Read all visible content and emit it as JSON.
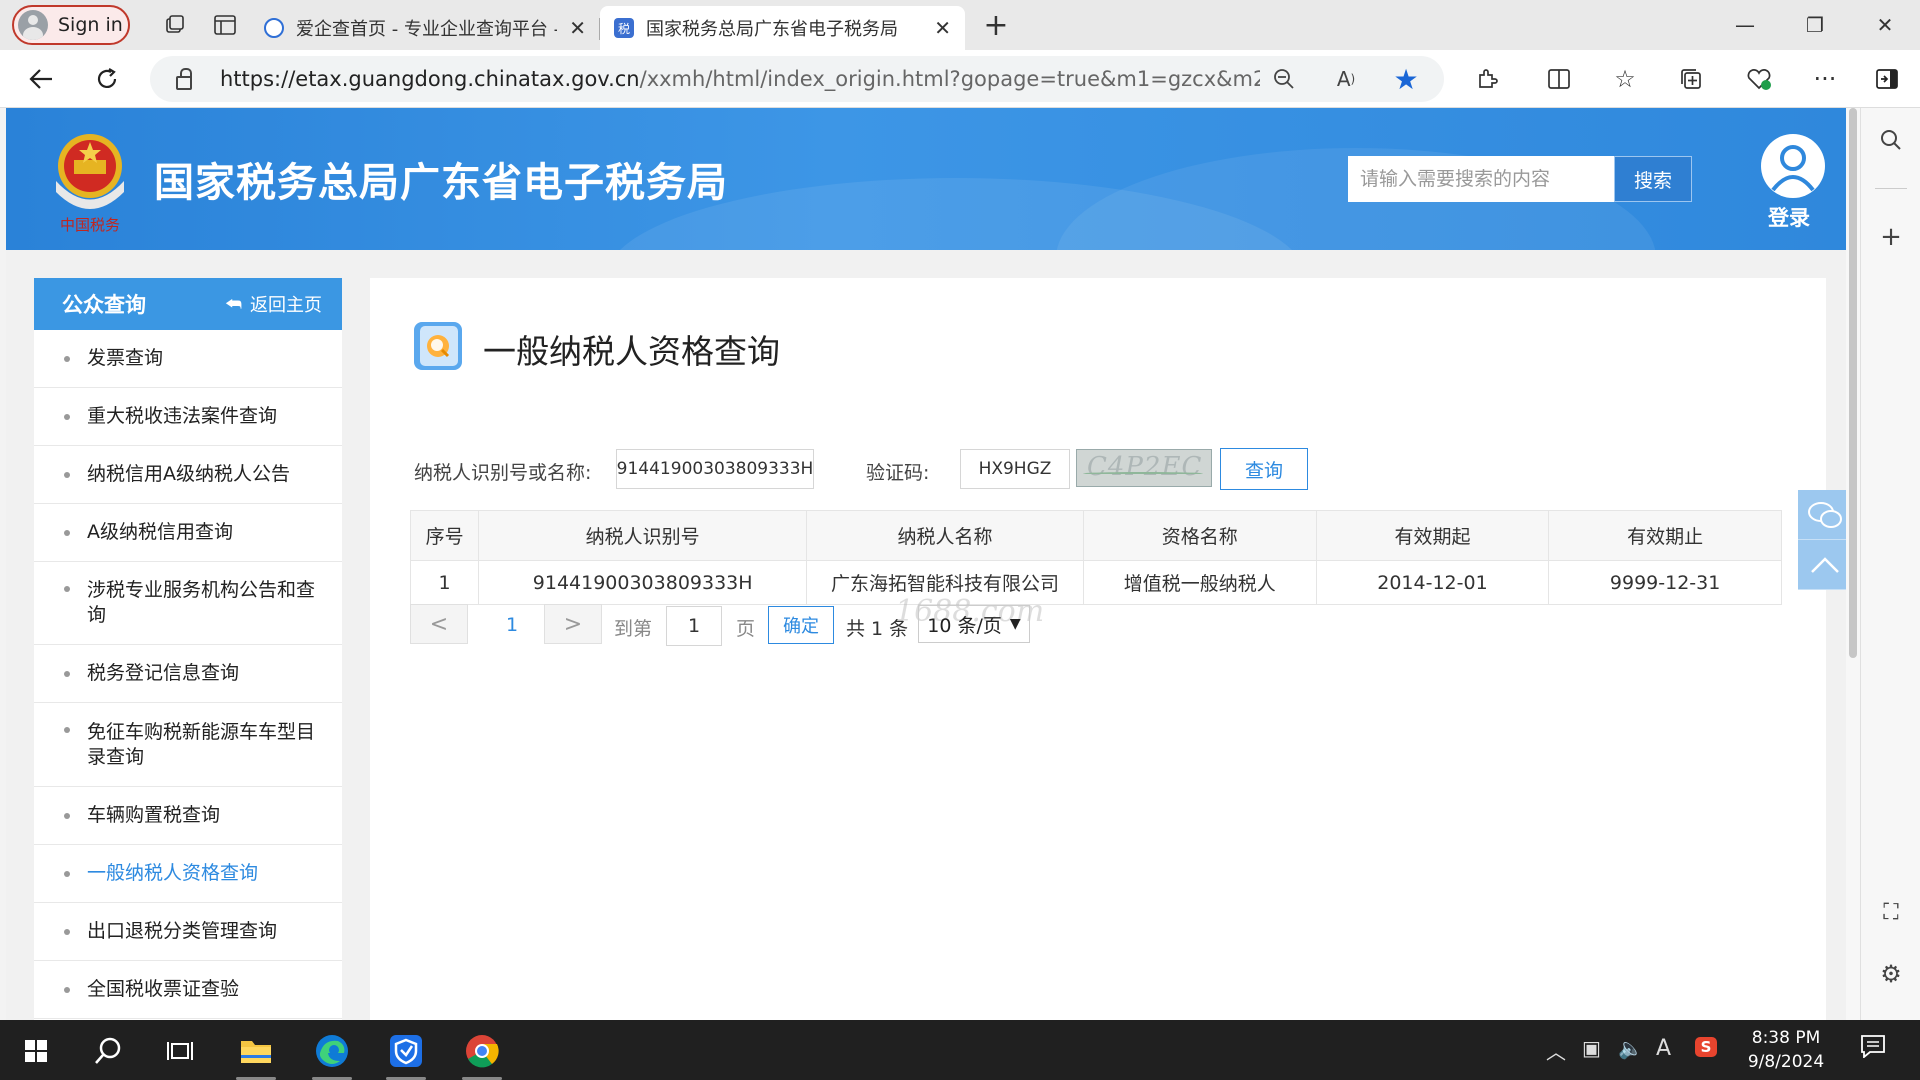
{
  "browser": {
    "signin_label": "Sign in",
    "tabs": [
      {
        "title": "爱企查首页 - 专业企业查询平台 -",
        "favicon_color": "#2f6fd6"
      },
      {
        "title": "国家税务总局广东省电子税务局",
        "favicon_color": "#3b6fd0"
      }
    ],
    "url_main": "https://etax.guangdong.chinatax.gov.cn",
    "url_rest": "/xxmh/html/index_origin.html?gopage=true&m1=gzcx&m2=&from..."
  },
  "site": {
    "title": "国家税务总局广东省电子税务局",
    "search_placeholder": "请输入需要搜索的内容",
    "search_button": "搜索",
    "login_label": "登录",
    "emblem_caption": "中国税务"
  },
  "menu": {
    "header": "公众查询",
    "back_label": "返回主页",
    "items": [
      {
        "label": "发票查询"
      },
      {
        "label": "重大税收违法案件查询"
      },
      {
        "label": "纳税信用A级纳税人公告"
      },
      {
        "label": "A级纳税信用查询"
      },
      {
        "label": "涉税专业服务机构公告和查询"
      },
      {
        "label": "税务登记信息查询"
      },
      {
        "label": "免征车购税新能源车车型目录查询"
      },
      {
        "label": "车辆购置税查询"
      },
      {
        "label": "一般纳税人资格查询"
      },
      {
        "label": "出口退税分类管理查询"
      },
      {
        "label": "全国税收票证查验"
      }
    ],
    "active_index": 8
  },
  "main": {
    "title": "一般纳税人资格查询",
    "taxpayer_label": "纳税人识别号或名称:",
    "taxpayer_value": "91441900303809333H",
    "captcha_label": "验证码:",
    "captcha_value": "HX9HGZ",
    "captcha_image_text": "C4P2EC",
    "query_button": "查询",
    "watermark": "1688.com",
    "table": {
      "headers": [
        "序号",
        "纳税人识别号",
        "纳税人名称",
        "资格名称",
        "有效期起",
        "有效期止"
      ],
      "rows": [
        [
          "1",
          "91441900303809333H",
          "广东海拓智能科技有限公司",
          "增值税一般纳税人",
          "2014-12-01",
          "9999-12-31"
        ]
      ]
    },
    "pager": {
      "prev": "<",
      "current_page": "1",
      "next": ">",
      "goto_label": "到第",
      "goto_value": "1",
      "page_unit": "页",
      "confirm": "确定",
      "total": "共 1 条",
      "page_size": "10 条/页"
    }
  },
  "taskbar": {
    "time": "8:38 PM",
    "date": "9/8/2024",
    "ime": "A"
  }
}
